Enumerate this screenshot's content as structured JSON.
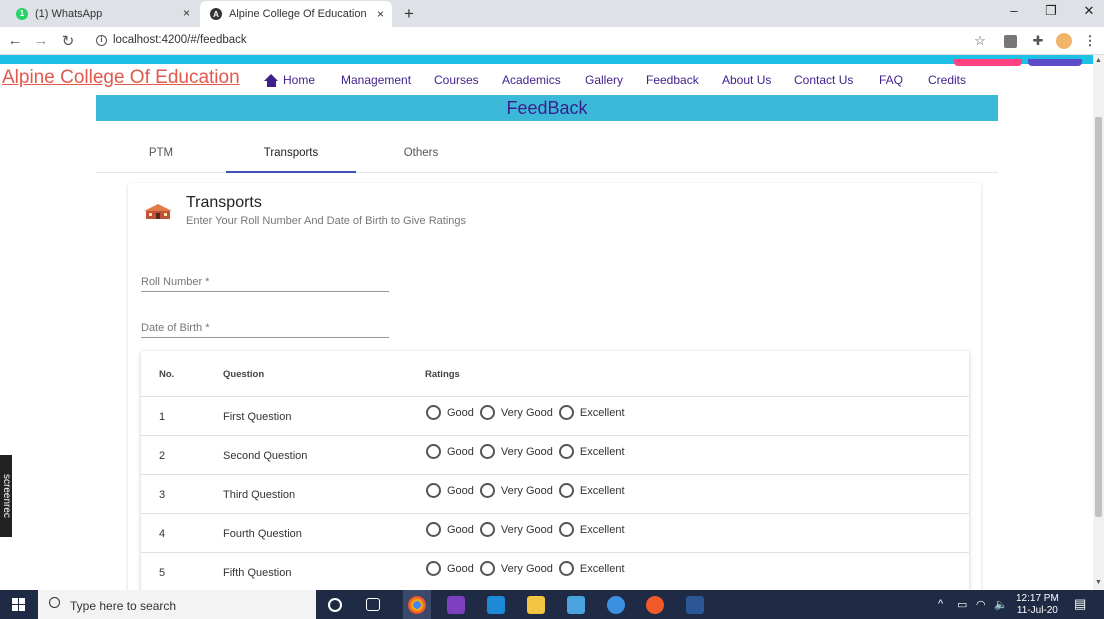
{
  "browser": {
    "tabs": [
      {
        "title": "(1) WhatsApp",
        "close": "×"
      },
      {
        "title": "Alpine College Of Education",
        "close": "×"
      }
    ],
    "new_tab": "+",
    "window_controls": {
      "minimize": "–",
      "restore": "❐",
      "close": "✕"
    },
    "nav": {
      "back": "←",
      "forward": "→",
      "reload": "↻"
    },
    "url": "localhost:4200/#/feedback",
    "icons": [
      "star-icon",
      "extension-icon",
      "puzzle-icon",
      "profile-avatar",
      "menu-icon"
    ]
  },
  "site": {
    "brand": "Alpine College Of Education",
    "nav": [
      "Home",
      "Management",
      "Courses",
      "Academics",
      "Gallery",
      "Feedback",
      "About Us",
      "Contact Us",
      "FAQ",
      "Credits"
    ],
    "colors": {
      "accent_cyan": "#1ec1e6",
      "nav_text": "#3f1f8c",
      "brand": "#e2584d",
      "pink": "#ff4081",
      "purple": "#5c4cc9"
    }
  },
  "feedback": {
    "banner": "FeedBack",
    "tabs": [
      "PTM",
      "Transports",
      "Others"
    ],
    "active_tab": "Transports",
    "card": {
      "title": "Transports",
      "subtitle": "Enter Your Roll Number And Date of Birth to Give Ratings",
      "roll_placeholder": "Roll Number *",
      "dob_placeholder": "Date of Birth *"
    },
    "table": {
      "headers": {
        "no": "No.",
        "question": "Question",
        "ratings": "Ratings"
      },
      "rating_options": [
        "Good",
        "Very Good",
        "Excellent"
      ],
      "rows": [
        {
          "no": "1",
          "question": "First Question"
        },
        {
          "no": "2",
          "question": "Second Question"
        },
        {
          "no": "3",
          "question": "Third Question"
        },
        {
          "no": "4",
          "question": "Fourth Question"
        },
        {
          "no": "5",
          "question": "Fifth Question"
        }
      ]
    }
  },
  "taskbar": {
    "search_placeholder": "Type here to search",
    "time": "12:17 PM",
    "date": "11-Jul-20"
  },
  "overlay": {
    "screenrec": "screenrec"
  }
}
